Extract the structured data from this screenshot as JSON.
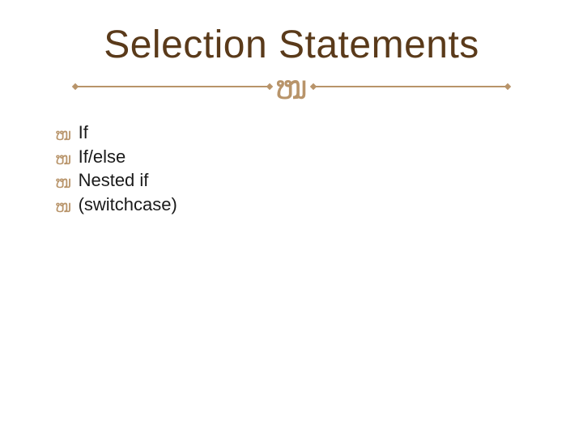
{
  "title": "Selection Statements",
  "flourish_glyph": "།",
  "bullet_glyph": "།",
  "items": [
    {
      "label": "If"
    },
    {
      "label": "If/else"
    },
    {
      "label": "Nested if"
    },
    {
      "label": "(switchcase)"
    }
  ],
  "colors": {
    "title": "#5a3a1a",
    "accent": "#b8946a",
    "text": "#1a1a1a"
  }
}
